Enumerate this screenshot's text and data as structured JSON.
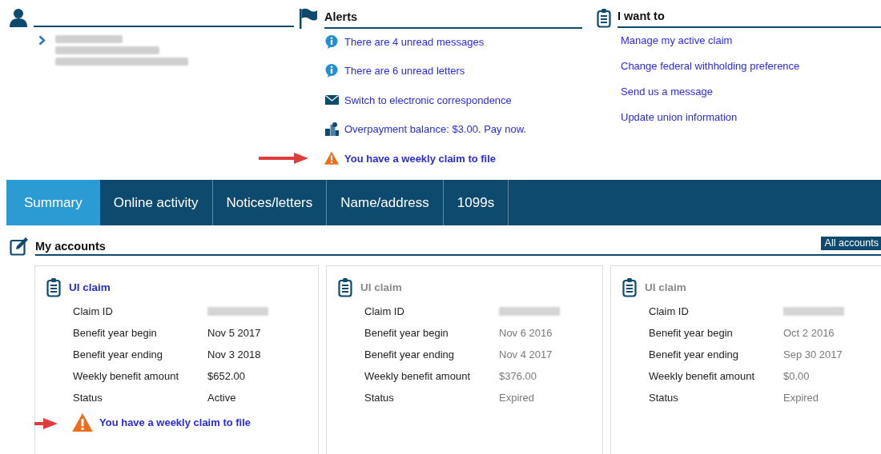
{
  "alerts": {
    "title": "Alerts",
    "items": [
      {
        "kind": "info",
        "text": "There are 4 unread messages"
      },
      {
        "kind": "info",
        "text": "There are 6 unread letters"
      },
      {
        "kind": "mail",
        "text": "Switch to electronic correspondence"
      },
      {
        "kind": "payment",
        "text": "Overpayment balance: $3.00. Pay now."
      },
      {
        "kind": "warning",
        "text": "You have a weekly claim to file"
      }
    ]
  },
  "i_want_to": {
    "title": "I want to",
    "links": [
      "Manage my active claim",
      "Change federal withholding preference",
      "Send us a message",
      "Update union information"
    ]
  },
  "tabs": [
    {
      "label": "Summary",
      "selected": true
    },
    {
      "label": "Online activity",
      "selected": false
    },
    {
      "label": "Notices/letters",
      "selected": false
    },
    {
      "label": "Name/address",
      "selected": false
    },
    {
      "label": "1099s",
      "selected": false
    }
  ],
  "accounts": {
    "title": "My accounts",
    "button": "All accounts",
    "cards": [
      {
        "title": "UI claim",
        "active": true,
        "fields": [
          {
            "label": "Claim ID"
          },
          {
            "label": "Benefit year begin",
            "value": "Nov 5 2017"
          },
          {
            "label": "Benefit year ending",
            "value": "Nov 3 2018"
          },
          {
            "label": "Weekly benefit amount",
            "value": "$652.00"
          },
          {
            "label": "Status",
            "value": "Active"
          }
        ],
        "alert": "You have a weekly claim to file"
      },
      {
        "title": "UI claim",
        "active": false,
        "fields": [
          {
            "label": "Claim ID"
          },
          {
            "label": "Benefit year begin",
            "value": "Nov 6 2016"
          },
          {
            "label": "Benefit year ending",
            "value": "Nov 4 2017"
          },
          {
            "label": "Weekly benefit amount",
            "value": "$376.00"
          },
          {
            "label": "Status",
            "value": "Expired"
          }
        ]
      },
      {
        "title": "UI claim",
        "active": false,
        "fields": [
          {
            "label": "Claim ID"
          },
          {
            "label": "Benefit year begin",
            "value": "Oct 2 2016"
          },
          {
            "label": "Benefit year ending",
            "value": "Sep 30 2017"
          },
          {
            "label": "Weekly benefit amount",
            "value": "$0.00"
          },
          {
            "label": "Status",
            "value": "Expired"
          }
        ]
      }
    ]
  }
}
